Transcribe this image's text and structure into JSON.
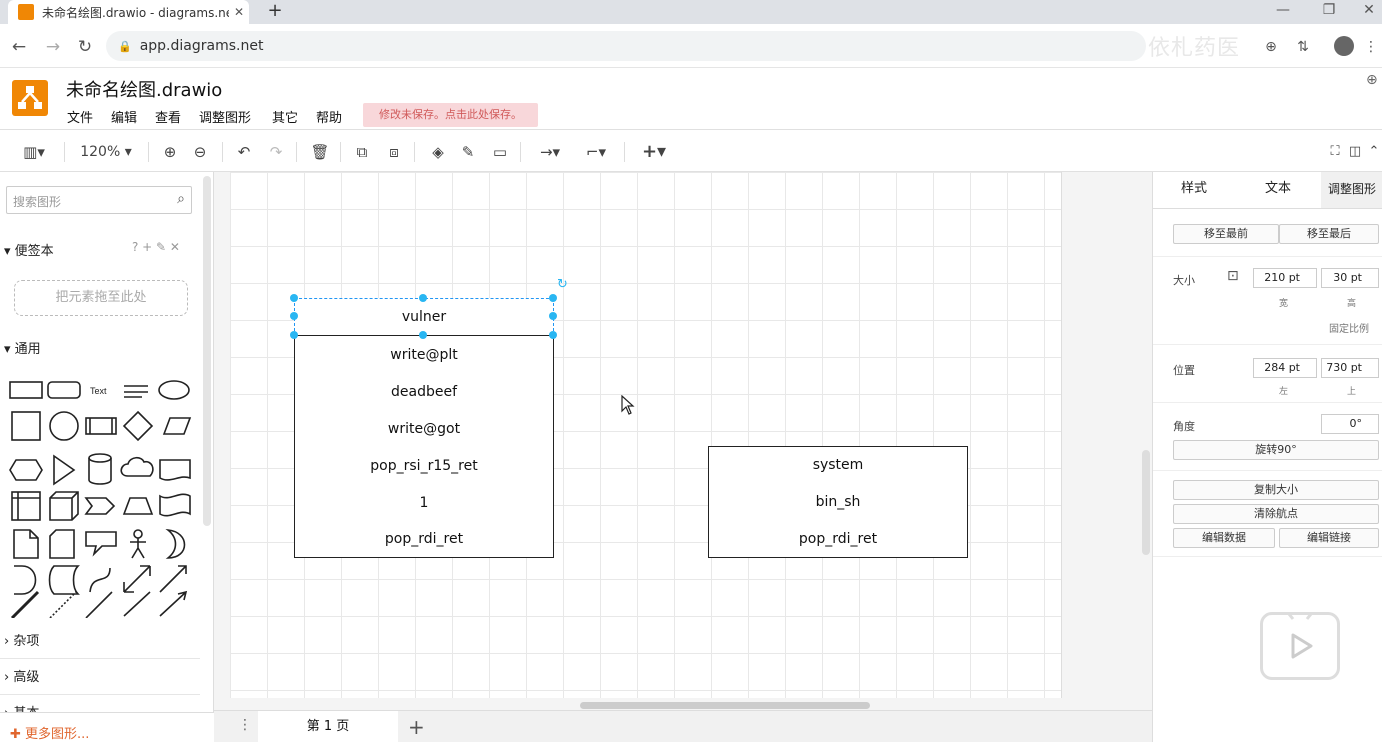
{
  "browser": {
    "tab_title": "未命名绘图.drawio - diagrams.net",
    "url": "app.diagrams.net",
    "new_tab": "+",
    "close_tab": "✕"
  },
  "app": {
    "title": "未命名绘图.drawio",
    "menu": [
      "文件",
      "编辑",
      "查看",
      "调整图形",
      "其它",
      "帮助"
    ],
    "save_notice": "修改未保存。点击此处保存。"
  },
  "toolbar": {
    "zoom": "120%"
  },
  "sidebar": {
    "search_placeholder": "搜索图形",
    "scratchpad_title": "便签本",
    "scratchpad_tools": "? + ✎ ✕",
    "dropzone": "把元素拖至此处",
    "general_title": "通用",
    "text_shape": "Text",
    "misc_title": "杂项",
    "advanced_title": "高级",
    "basic_title": "基本",
    "more_shapes": "更多图形..."
  },
  "diagram": {
    "left_stack": [
      "vulner",
      "write@plt",
      "deadbeef",
      "write@got",
      "pop_rsi_r15_ret",
      "1",
      "pop_rdi_ret"
    ],
    "right_stack": [
      "system",
      "bin_sh",
      "pop_rdi_ret"
    ]
  },
  "bottom": {
    "page_tab": "第 1 页",
    "add_page": "+"
  },
  "format_panel": {
    "tabs": [
      "样式",
      "文本",
      "调整图形"
    ],
    "to_front": "移至最前",
    "to_back": "移至最后",
    "size_label": "大小",
    "width": "210 pt",
    "height": "30 pt",
    "width_sub": "宽",
    "height_sub": "高",
    "constrain": "固定比例",
    "position_label": "位置",
    "left": "284 pt",
    "top": "730 pt",
    "left_sub": "左",
    "top_sub": "上",
    "angle_label": "角度",
    "angle": "0°",
    "rotate": "旋转90°",
    "copy_size": "复制大小",
    "clear_waypoints": "清除航点",
    "edit_data": "编辑数据",
    "edit_link": "编辑链接"
  },
  "overlay": {
    "watermark": "依札药医"
  }
}
